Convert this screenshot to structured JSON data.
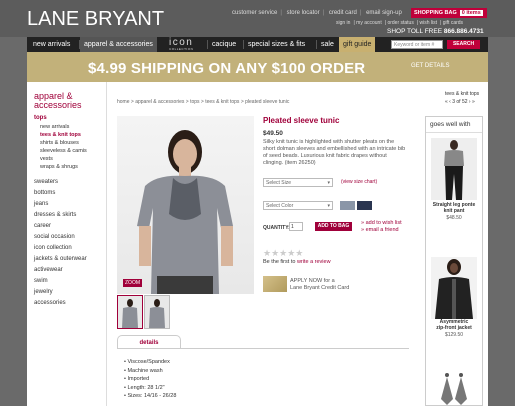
{
  "header": {
    "logo": "LANE BRYANT",
    "top_links": [
      "customer service",
      "store locator",
      "credit card",
      "email sign-up"
    ],
    "shopping_bag_label": "SHOPPING BAG",
    "shopping_bag_count": "0 items",
    "sub_links": [
      "sign in",
      "my account",
      "order status",
      "wish list",
      "gift cards"
    ],
    "toll_free_label": "SHOP TOLL FREE",
    "toll_free_number": "866.886.4731"
  },
  "nav": {
    "items": [
      "new arrivals",
      "apparel & accessories",
      "icon",
      "cacique",
      "special sizes & fits",
      "sale",
      "gift guide"
    ],
    "icon_sub": "COLLECTION",
    "search_placeholder": "Keyword or item #",
    "search_button": "SEARCH"
  },
  "banner": {
    "text": "$4.99 SHIPPING ON ANY $100 ORDER",
    "details": "GET DETAILS"
  },
  "sidebar": {
    "heading_line1": "apparel &",
    "heading_line2": "accessories",
    "tops_label": "tops",
    "tops_sub": [
      "new arrivals",
      "tees & knit tops",
      "shirts & blouses",
      "sleeveless & camis",
      "vests",
      "wraps & shrugs"
    ],
    "categories": [
      "sweaters",
      "bottoms",
      "jeans",
      "dresses & skirts",
      "career",
      "social occasion",
      "icon collection",
      "jackets & outerwear",
      "activewear",
      "swim",
      "jewelry",
      "accessories"
    ]
  },
  "breadcrumb": {
    "path": "home  >  apparel & accessories  >  tops  >  tees & knit tops  >  pleated sleeve tunic",
    "section": "tees & knit tops",
    "pager": "«  ‹  3 of 52  ›  »"
  },
  "product": {
    "title": "Pleated sleeve tunic",
    "price": "$49.50",
    "description": "Silky knit tunic is highlighted with shutter pleats on the short dolman sleeves and embellished with an intricate bib of seed beads. Luxurious knit fabric drapes without clinging.",
    "item_no": "(item 26250)",
    "size_select": "Select Size",
    "size_chart": "(view size chart)",
    "color_select": "Select Color",
    "quantity_label": "QUANTITY:",
    "quantity_value": "1",
    "add_to_bag": "ADD TO BAG",
    "wish_list": "add to wish list",
    "email_friend": "email a friend",
    "review_prefix": "Be the first to",
    "review_link": "write a review",
    "cc_line1": "APPLY NOW for a",
    "cc_line2": "Lane Bryant Credit Card",
    "zoom": "ZOOM",
    "details_tab": "details",
    "details": [
      "Viscose/Spandex",
      "Machine wash",
      "Imported",
      "Length: 28 1/2\"",
      "Sizes: 14/16 - 26/28"
    ]
  },
  "goes_well": {
    "heading": "goes well with",
    "items": [
      {
        "name_line1": "Straight leg ponte",
        "name_line2": "knit pant",
        "price": "$48.50"
      },
      {
        "name_line1": "Asymmetric",
        "name_line2": "zip-front jacket",
        "price": "$129.50"
      }
    ]
  },
  "colors": {
    "brand": "#a0003a",
    "banner": "#c2b17a",
    "swatch_grey": "#8a96a8",
    "swatch_navy": "#2a3550"
  }
}
